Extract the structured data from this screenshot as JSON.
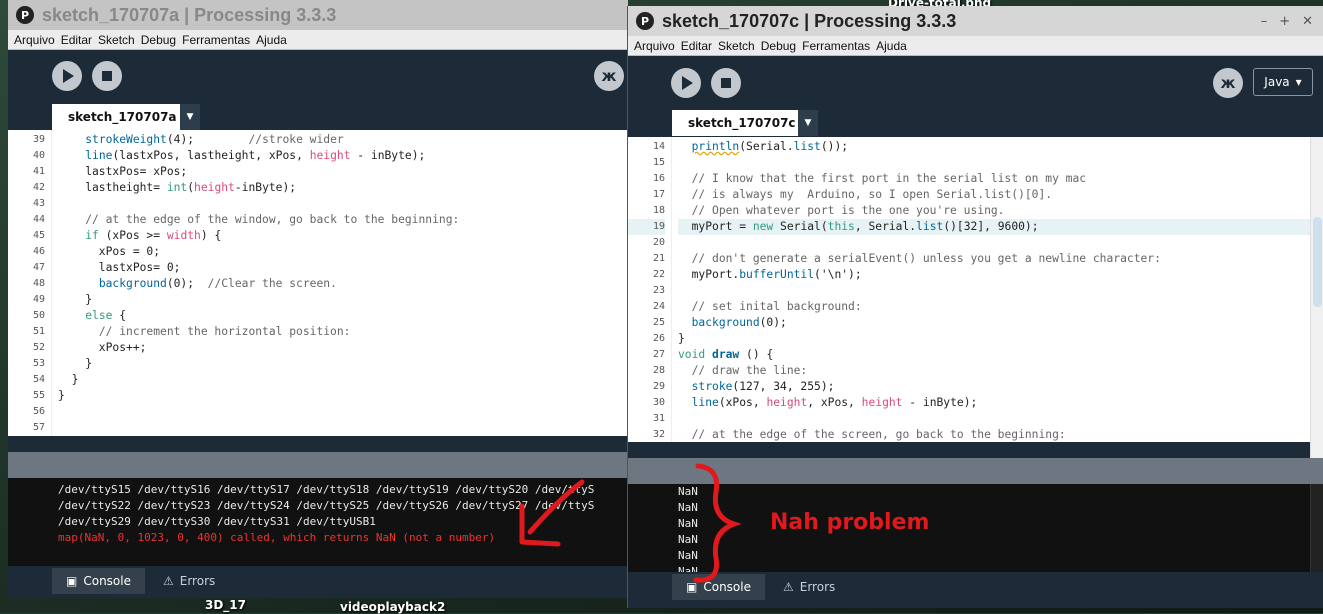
{
  "desktop": {
    "labels": [
      "Drive-total.png",
      "3D_17",
      "videoplayback2"
    ]
  },
  "window_a": {
    "title": "sketch_170707a | Processing 3.3.3",
    "menu": [
      "Arquivo",
      "Editar",
      "Sketch",
      "Debug",
      "Ferramentas",
      "Ajuda"
    ],
    "tab_label": "sketch_170707a",
    "line_numbers": [
      "39",
      "40",
      "41",
      "42",
      "43",
      "44",
      "45",
      "46",
      "47",
      "48",
      "49",
      "50",
      "51",
      "52",
      "53",
      "54",
      "55",
      "56",
      "57"
    ],
    "console_lines": [
      "/dev/ttyS15 /dev/ttyS16 /dev/ttyS17 /dev/ttyS18 /dev/ttyS19 /dev/ttyS20 /dev/ttyS",
      "/dev/ttyS22 /dev/ttyS23 /dev/ttyS24 /dev/ttyS25 /dev/ttyS26 /dev/ttyS27 /dev/ttyS",
      "/dev/ttyS29 /dev/ttyS30 /dev/ttyS31 /dev/ttyUSB1"
    ],
    "console_error": "map(NaN, 0, 1023, 0, 400) called, which returns NaN (not a number)",
    "console_tab": "Console",
    "errors_tab": "Errors"
  },
  "window_c": {
    "title": "sketch_170707c | Processing 3.3.3",
    "menu": [
      "Arquivo",
      "Editar",
      "Sketch",
      "Debug",
      "Ferramentas",
      "Ajuda"
    ],
    "mode": "Java",
    "tab_label": "sketch_170707c",
    "line_numbers": [
      "14",
      "15",
      "16",
      "17",
      "18",
      "19",
      "20",
      "21",
      "22",
      "23",
      "24",
      "25",
      "26",
      "27",
      "28",
      "29",
      "30",
      "31",
      "32"
    ],
    "console_lines": [
      "NaN",
      "NaN",
      "NaN",
      "NaN",
      "NaN",
      "NaN"
    ],
    "console_tab": "Console",
    "errors_tab": "Errors"
  },
  "annotation": {
    "text": "Nah problem",
    "color": "#e0191d"
  },
  "colors": {
    "ide_dark": "#1d2b38",
    "keyword": "#33997e",
    "function": "#006699",
    "variable": "#d94a7a",
    "error": "#e33333"
  }
}
